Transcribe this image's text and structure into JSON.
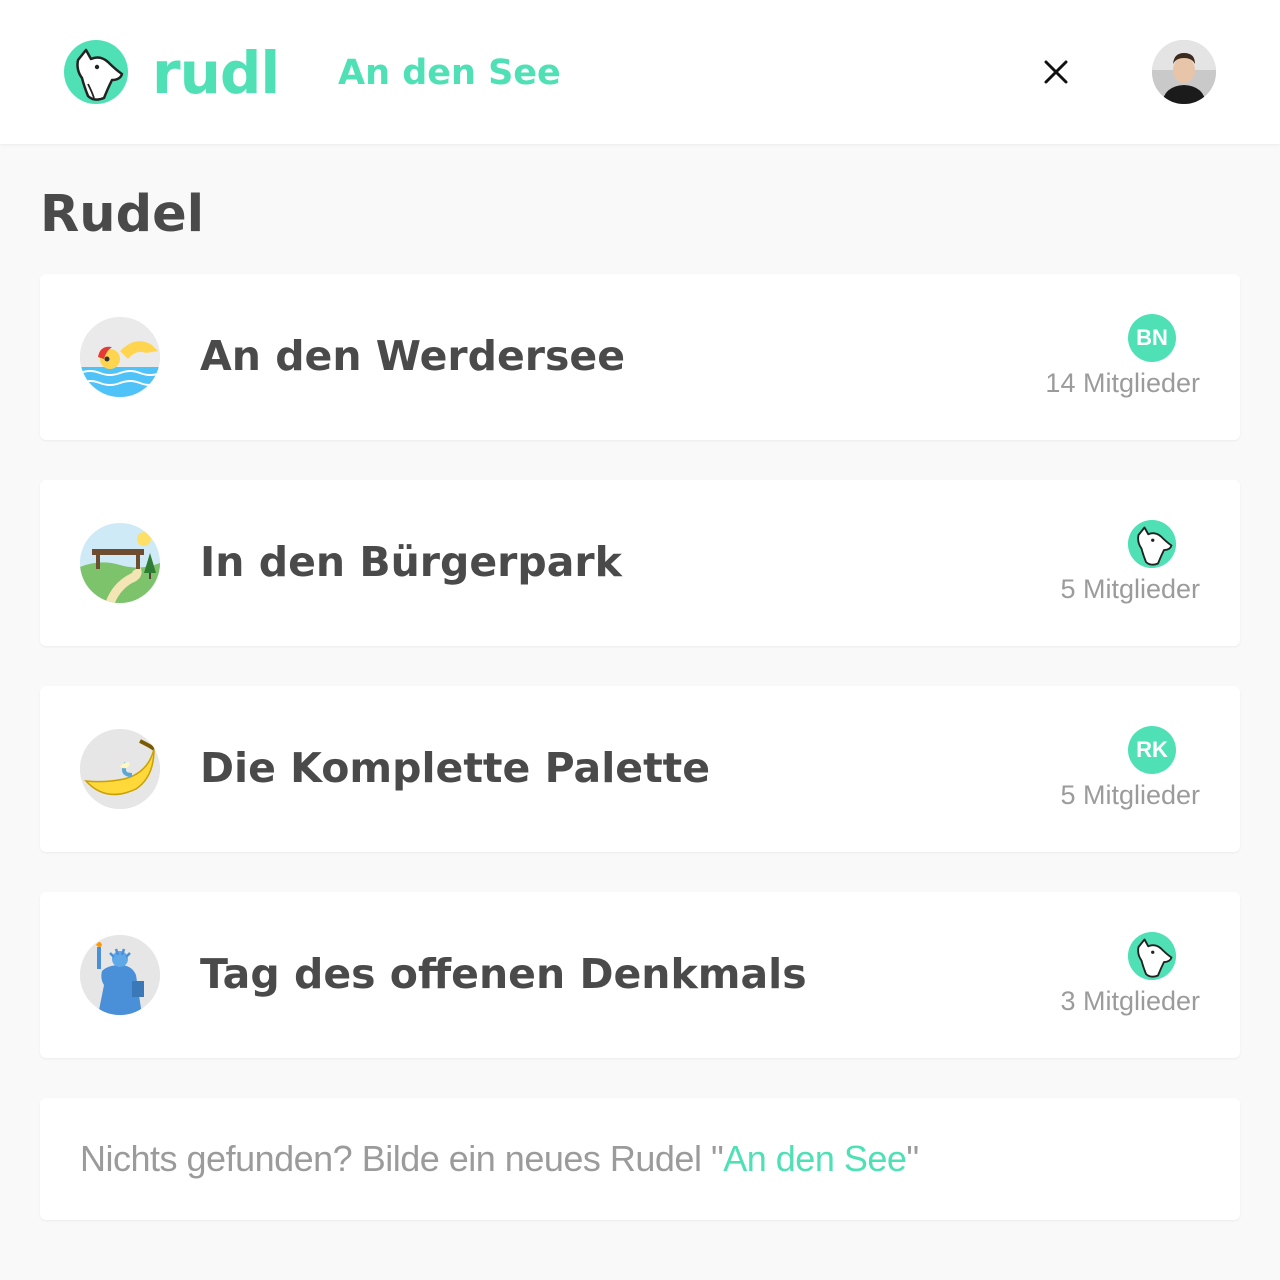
{
  "header": {
    "logo_text": "rudl",
    "search_query": "An den See",
    "close_icon": "close-icon",
    "avatar_icon": "user-avatar"
  },
  "section": {
    "title": "Rudel"
  },
  "groups": [
    {
      "name": "An den Werdersee",
      "icon": "swimmer-icon",
      "badge": "BN",
      "members": "14 Mitglieder"
    },
    {
      "name": "In den Bürgerpark",
      "icon": "park-icon",
      "badge": "",
      "badge_icon": "wolf-icon",
      "members": "5 Mitglieder"
    },
    {
      "name": "Die Komplette Palette",
      "icon": "banana-icon",
      "badge": "RK",
      "members": "5 Mitglieder"
    },
    {
      "name": "Tag des offenen Denkmals",
      "icon": "statue-of-liberty-icon",
      "badge": "",
      "badge_icon": "wolf-icon",
      "members": "3 Mitglieder"
    }
  ],
  "create": {
    "prefix": "Nichts gefunden? Bilde ein neues Rudel \"",
    "query": "An den See",
    "suffix": "\""
  },
  "colors": {
    "accent": "#4fe0b6",
    "text": "#4a4a4a",
    "muted": "#9b9b9b",
    "background": "#f9f9f9"
  }
}
